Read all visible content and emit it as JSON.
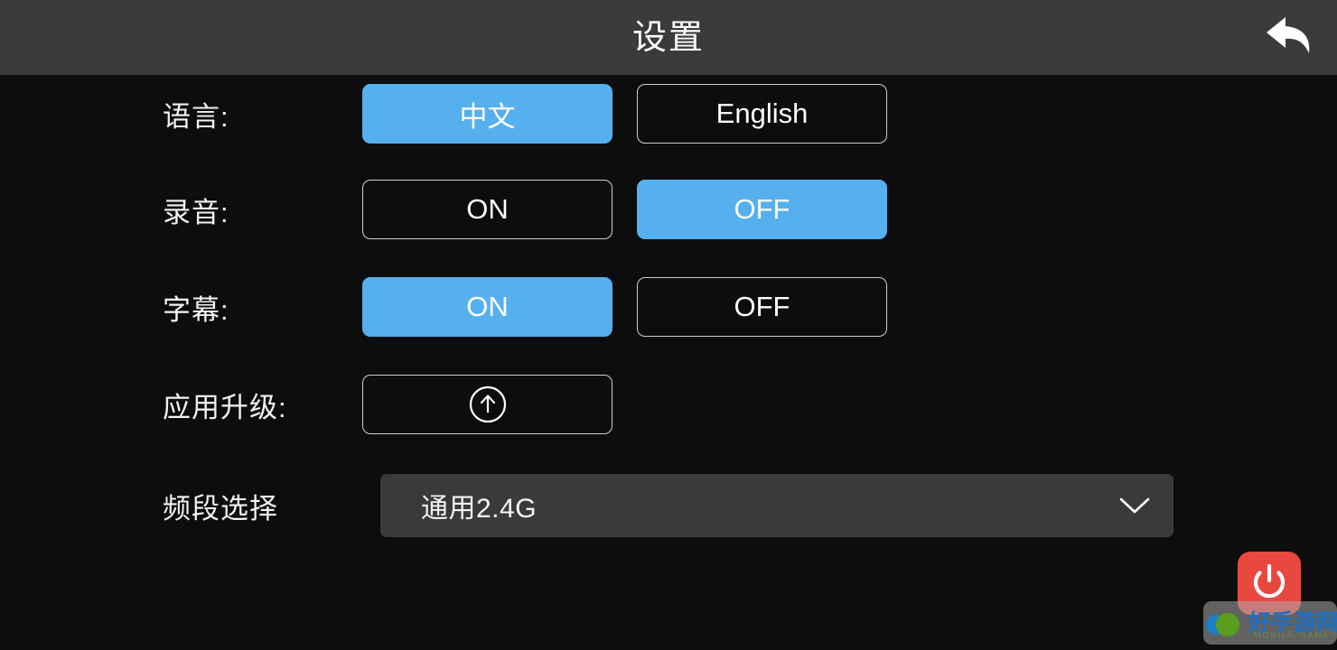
{
  "header": {
    "title": "设置",
    "back_icon": "back-arrow-icon"
  },
  "colors": {
    "header_bg": "#3b3b3b",
    "page_bg": "#0d0d0d",
    "accent_selected": "#56b0ee",
    "button_border": "#cfcfcf",
    "dropdown_bg": "#3a3a3a",
    "power_red": "#e9483f",
    "watermark_text": "#1b6fc4"
  },
  "rows": [
    {
      "label": "语言:",
      "type": "toggle-pair",
      "options": [
        {
          "text": "中文",
          "selected": true
        },
        {
          "text": "English",
          "selected": false
        }
      ]
    },
    {
      "label": "录音:",
      "type": "toggle-pair",
      "options": [
        {
          "text": "ON",
          "selected": false
        },
        {
          "text": "OFF",
          "selected": true
        }
      ]
    },
    {
      "label": "字幕:",
      "type": "toggle-pair",
      "options": [
        {
          "text": "ON",
          "selected": true
        },
        {
          "text": "OFF",
          "selected": false
        }
      ]
    },
    {
      "label": "应用升级:",
      "type": "icon-button",
      "icon": "circle-up-arrow-icon"
    },
    {
      "label": "频段选择",
      "type": "dropdown",
      "value": "通用2.4G",
      "chevron_icon": "chevron-down-icon"
    }
  ],
  "power_button": {
    "icon": "power-icon"
  },
  "watermark": {
    "text": "好手游网",
    "subtitle": "MOBILE GAMES",
    "logo_icon": "watermark-logo-icon"
  }
}
